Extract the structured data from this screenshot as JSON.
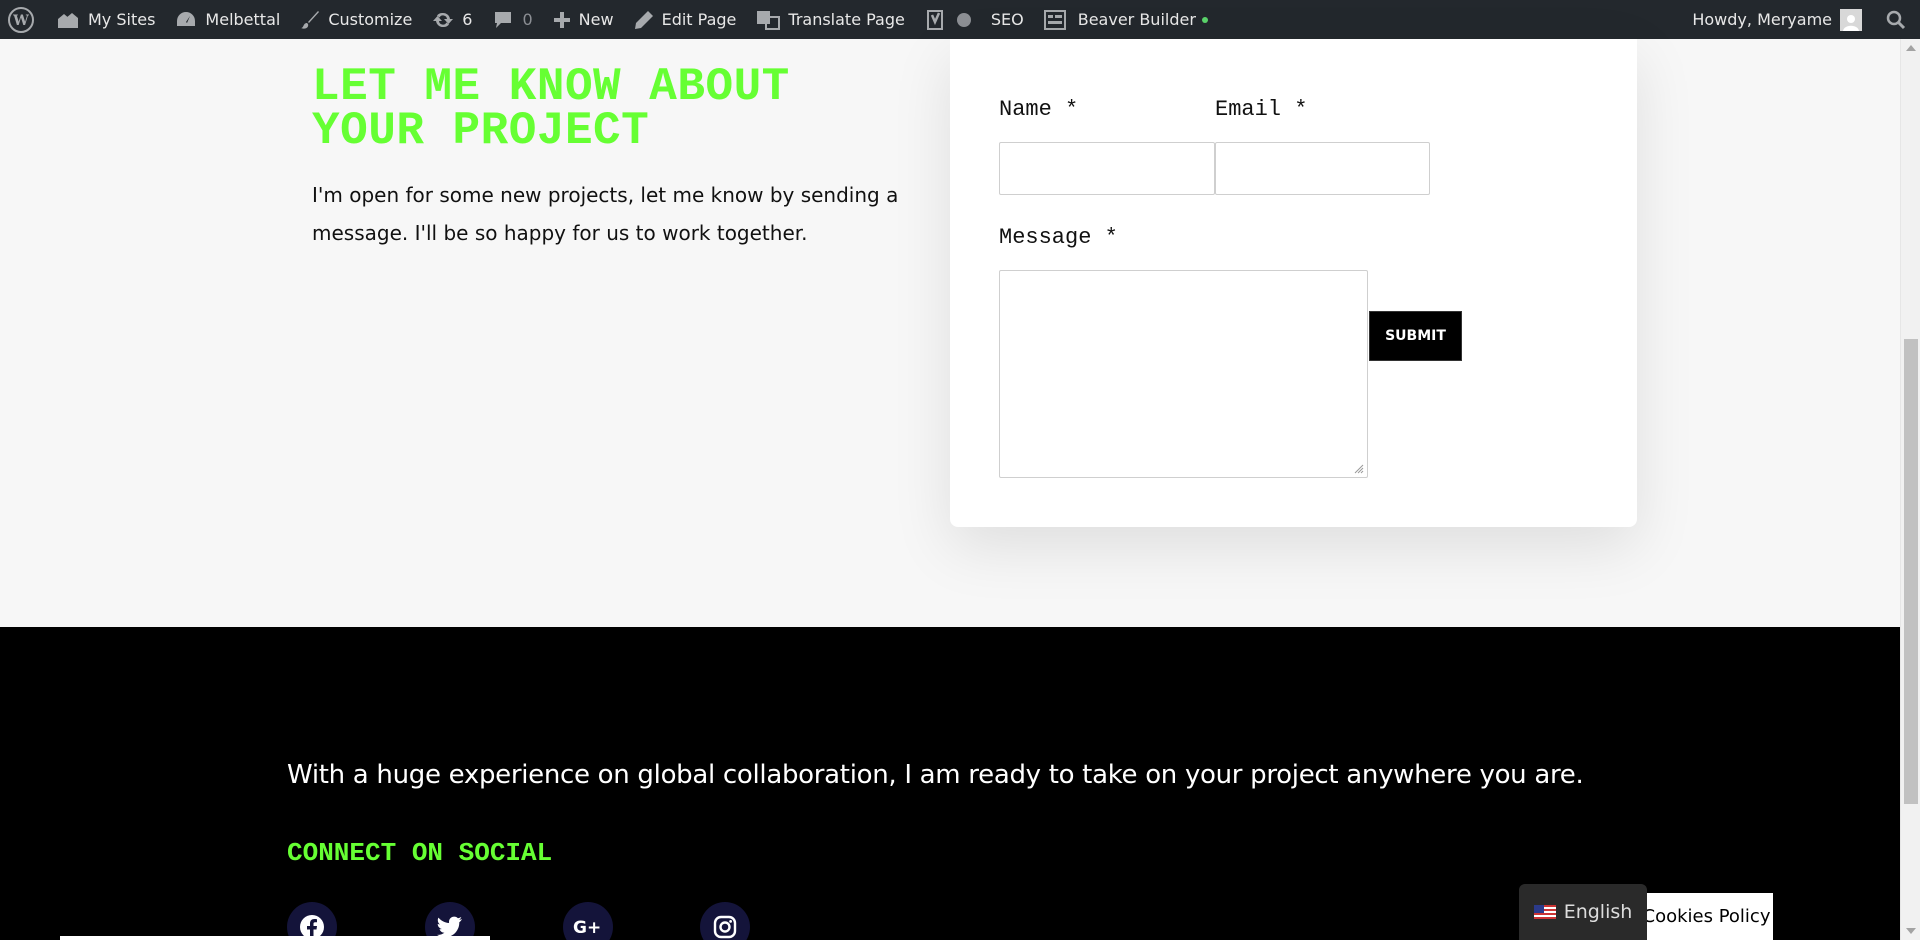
{
  "adminbar": {
    "my_sites": "My Sites",
    "site_name": "Melbettal",
    "customize": "Customize",
    "updates_count": "6",
    "comments_count": "0",
    "new": "New",
    "edit_page": "Edit Page",
    "translate_page": "Translate Page",
    "seo": "SEO",
    "beaver_builder": "Beaver Builder",
    "howdy": "Howdy, Meryame"
  },
  "contact": {
    "heading": "LET ME KNOW ABOUT YOUR PROJECT",
    "intro": "I'm open for some new projects, let me know by sending a message. I'll be so happy for us to work together.",
    "name_label": "Name *",
    "email_label": "Email *",
    "message_label": "Message *",
    "submit_label": "SUBMIT"
  },
  "footer": {
    "tagline": "With a huge experience on global collaboration, I am ready to take on your project anywhere you are.",
    "connect_heading": "CONNECT ON SOCIAL",
    "socials": [
      "facebook-icon",
      "twitter-icon",
      "google-plus-icon",
      "instagram-icon"
    ]
  },
  "language_switcher": {
    "label": "English"
  },
  "cookies": {
    "label": "Cookies Policy"
  },
  "colors": {
    "accent_green": "#66ff33",
    "admin_bar": "#23282d",
    "footer_bg": "#000000",
    "social_bg": "#14143a"
  }
}
